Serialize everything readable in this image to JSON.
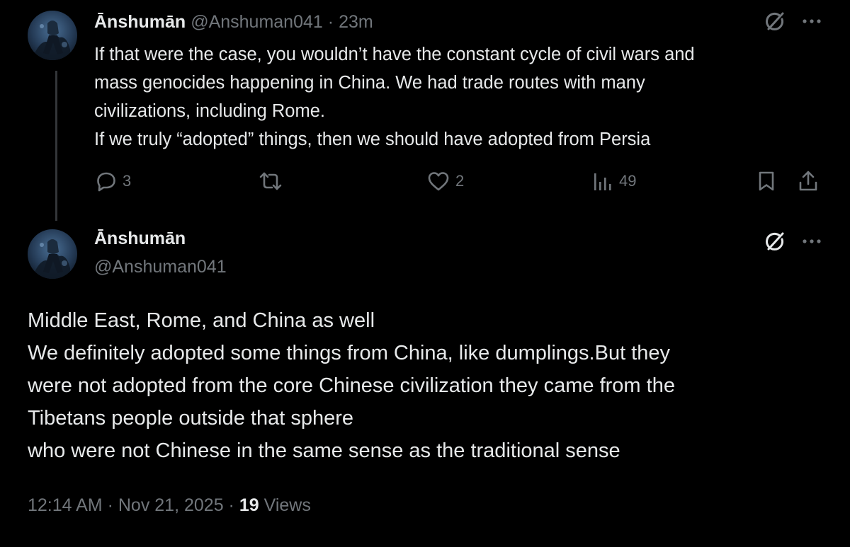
{
  "reply": {
    "display_name": "Ānshumān",
    "handle": "@Anshuman041",
    "separator": "·",
    "time": "23m",
    "text_lines": [
      "If that were the case, you wouldn’t have the constant cycle of civil wars and",
      "mass genocides happening in China. We had trade routes with many",
      "civilizations, including Rome.",
      "If we truly “adopted” things, then we should have adopted from Persia"
    ],
    "actions": {
      "reply_count": "3",
      "repost_count": "",
      "like_count": "2",
      "view_count": "49"
    }
  },
  "main": {
    "display_name": "Ānshumān",
    "handle": "@Anshuman041",
    "text_lines": [
      "Middle East, Rome, and China as well",
      "We definitely adopted some things from China, like dumplings.But they",
      "were not adopted from the core Chinese civilization they came from the",
      "Tibetans people outside that sphere",
      "who were not Chinese in the same sense as the traditional sense"
    ],
    "meta": {
      "time": "12:14 AM",
      "sep1": "·",
      "date": "Nov 21, 2025",
      "sep2": "·",
      "views_count": "19",
      "views_label": "Views"
    }
  },
  "icons": {
    "reply": "reply-icon",
    "repost": "repost-icon",
    "like": "heart-icon",
    "views": "analytics-icon",
    "bookmark": "bookmark-icon",
    "share": "share-icon",
    "grok": "grok-icon",
    "more": "more-icon"
  },
  "colors": {
    "background": "#000000",
    "text_primary": "#e7e9ea",
    "text_secondary": "#71767b",
    "thread_line": "#333639"
  }
}
